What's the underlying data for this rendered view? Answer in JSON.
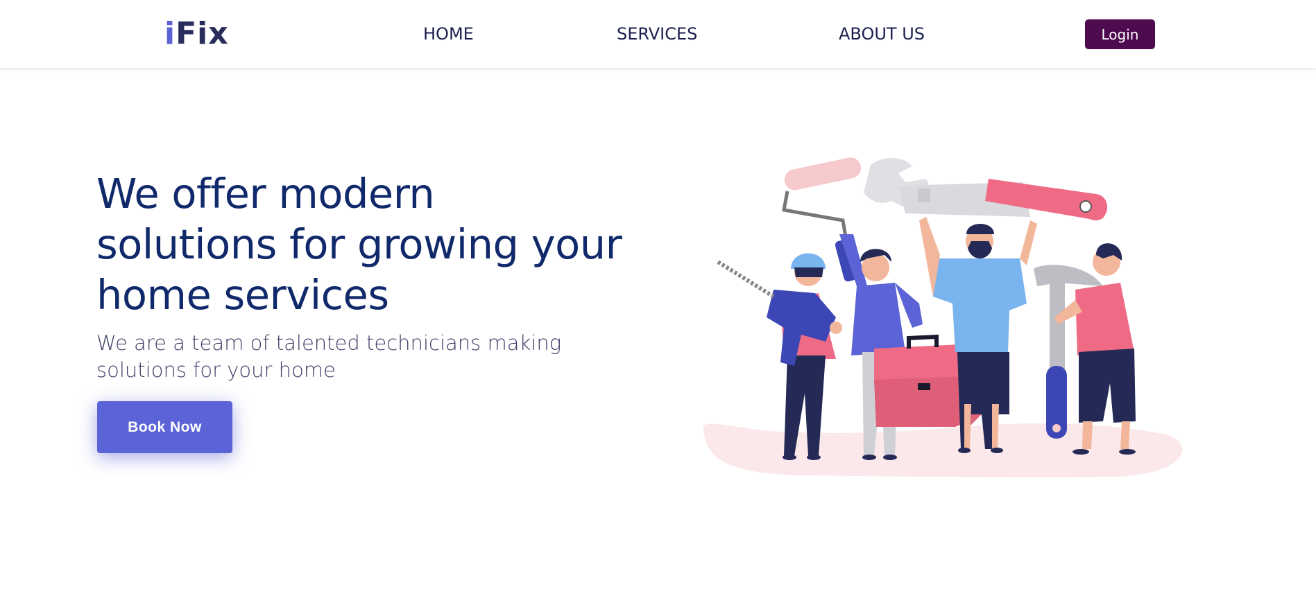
{
  "nav": {
    "logo_i": "i",
    "logo_rest": "Fix",
    "links": [
      "HOME",
      "SERVICES",
      "ABOUT US"
    ],
    "login_label": "Login"
  },
  "hero": {
    "title": "We offer modern solutions for growing your home services",
    "subtitle": "We are a team of talented technicians making solutions for your home",
    "cta_label": "Book Now"
  },
  "illustration": {
    "name": "technicians-with-tools-illustration"
  },
  "colors": {
    "brand_accent": "#5b63d6",
    "login_button": "#4e0a4e",
    "title_text": "#10296b",
    "navy": "#242a55",
    "pink": "#ef6b85",
    "blob": "#fbe8ea"
  }
}
